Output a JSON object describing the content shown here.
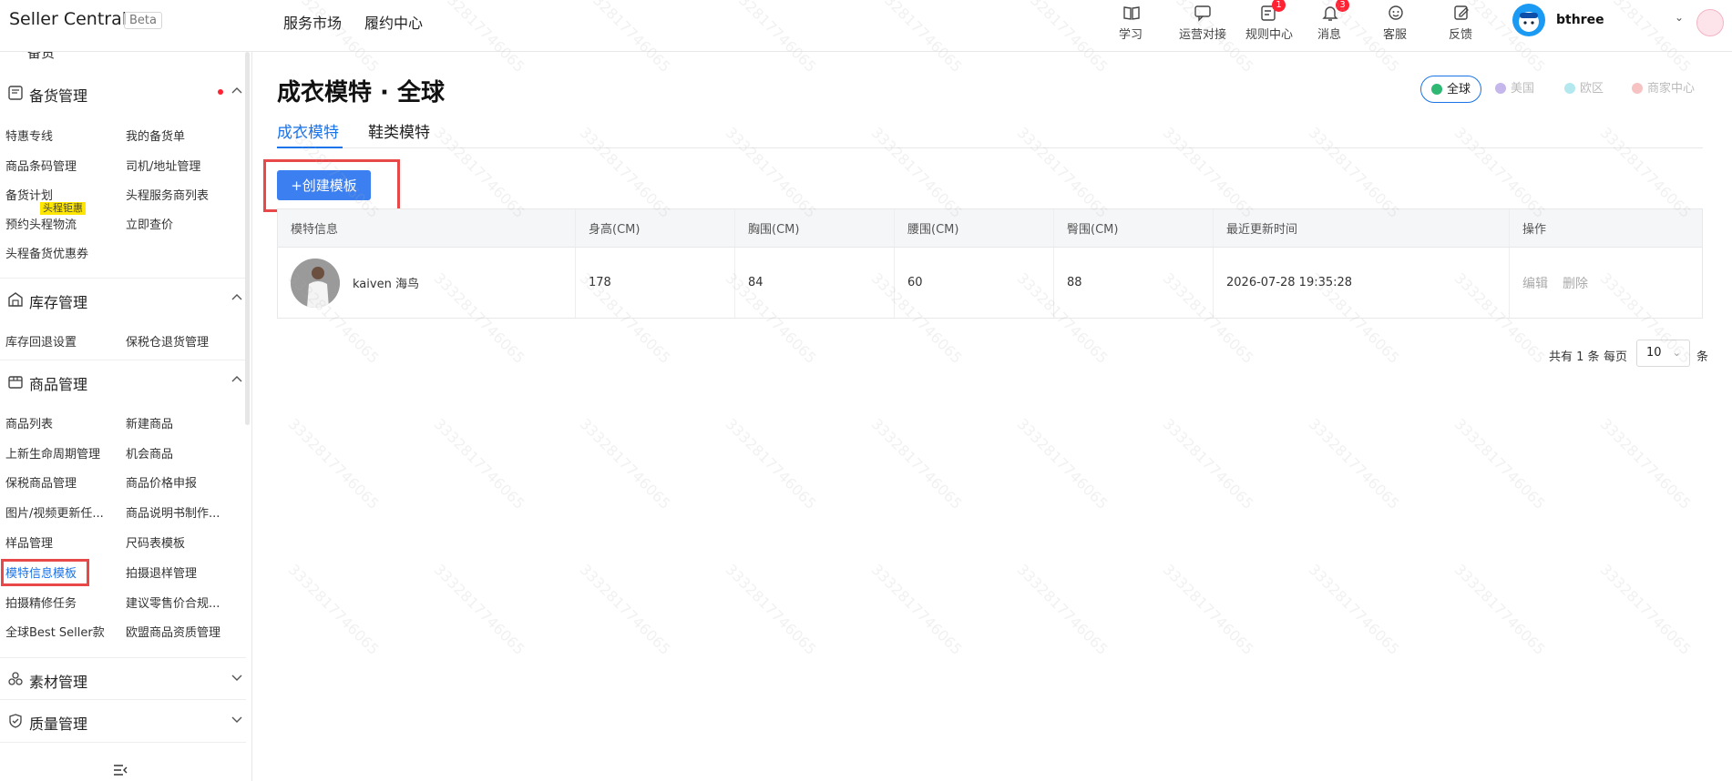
{
  "header": {
    "brand": "Seller Central",
    "beta": "Beta",
    "nav": [
      "服务市场",
      "履约中心"
    ],
    "tools": [
      {
        "label": "学习",
        "icon": "book-icon",
        "badge": ""
      },
      {
        "label": "运营对接",
        "icon": "chat-icon",
        "badge": ""
      },
      {
        "label": "规则中心",
        "icon": "rules-icon",
        "badge": "1"
      },
      {
        "label": "消息",
        "icon": "bell-icon",
        "badge": "3"
      },
      {
        "label": "客服",
        "icon": "headset-icon",
        "badge": ""
      },
      {
        "label": "反馈",
        "icon": "feedback-icon",
        "badge": ""
      }
    ],
    "username": "bthree"
  },
  "sidebar": {
    "top_partial": "备货",
    "groups": [
      {
        "title": "备货管理",
        "icon": "clipboard-icon",
        "expanded": true,
        "links": [
          "特惠专线",
          "我的备货单",
          "商品条码管理",
          "司机/地址管理",
          "备货计划",
          "头程服务商列表",
          "预约头程物流",
          "立即查价",
          "头程备货优惠券"
        ]
      },
      {
        "title": "库存管理",
        "icon": "warehouse-icon",
        "expanded": true,
        "links": [
          "库存回退设置",
          "保税仓退货管理"
        ]
      },
      {
        "title": "商品管理",
        "icon": "package-icon",
        "expanded": true,
        "links": [
          "商品列表",
          "新建商品",
          "上新生命周期管理",
          "机会商品",
          "保税商品管理",
          "商品价格申报",
          "图片/视频更新任...",
          "商品说明书制作...",
          "样品管理",
          "尺码表模板",
          "模特信息模板",
          "拍摄退样管理",
          "拍摄精修任务",
          "建议零售价合规...",
          "全球Best Seller款",
          "欧盟商品资质管理"
        ]
      },
      {
        "title": "素材管理",
        "icon": "material-icon",
        "expanded": false,
        "links": []
      },
      {
        "title": "质量管理",
        "icon": "shield-check-icon",
        "expanded": false,
        "links": []
      }
    ],
    "promo_badge": "头程钜惠",
    "active_link": "模特信息模板"
  },
  "main": {
    "title": "成衣模特 · 全球",
    "regions": [
      {
        "label": "全球",
        "color": "#2eb872",
        "active": true
      },
      {
        "label": "美国",
        "color": "#8c6bd8",
        "active": false
      },
      {
        "label": "欧区",
        "color": "#34c6d8",
        "active": false
      },
      {
        "label": "商家中心",
        "color": "#f06a6a",
        "active": false
      }
    ],
    "tabs": [
      "成衣模特",
      "鞋类模特"
    ],
    "create_button": "+创建模板",
    "table": {
      "headers": [
        "模特信息",
        "身高(CM)",
        "胸围(CM)",
        "腰围(CM)",
        "臀围(CM)",
        "最近更新时间",
        "操作"
      ],
      "rows": [
        {
          "name": "kaiven 海鸟",
          "height": "178",
          "bust": "84",
          "waist": "60",
          "hip": "88",
          "updated": "2026-07-28 19:35:28",
          "ops": [
            "编辑",
            "删除"
          ]
        }
      ]
    },
    "pagination": {
      "total": "共有 1 条",
      "per_page_label": "每页",
      "page_size": "10",
      "unit": "条"
    }
  },
  "watermark": "3332817746065",
  "colors": {
    "accent": "#1a73e8",
    "button": "#3b7ff0",
    "highlight": "#e84848"
  }
}
